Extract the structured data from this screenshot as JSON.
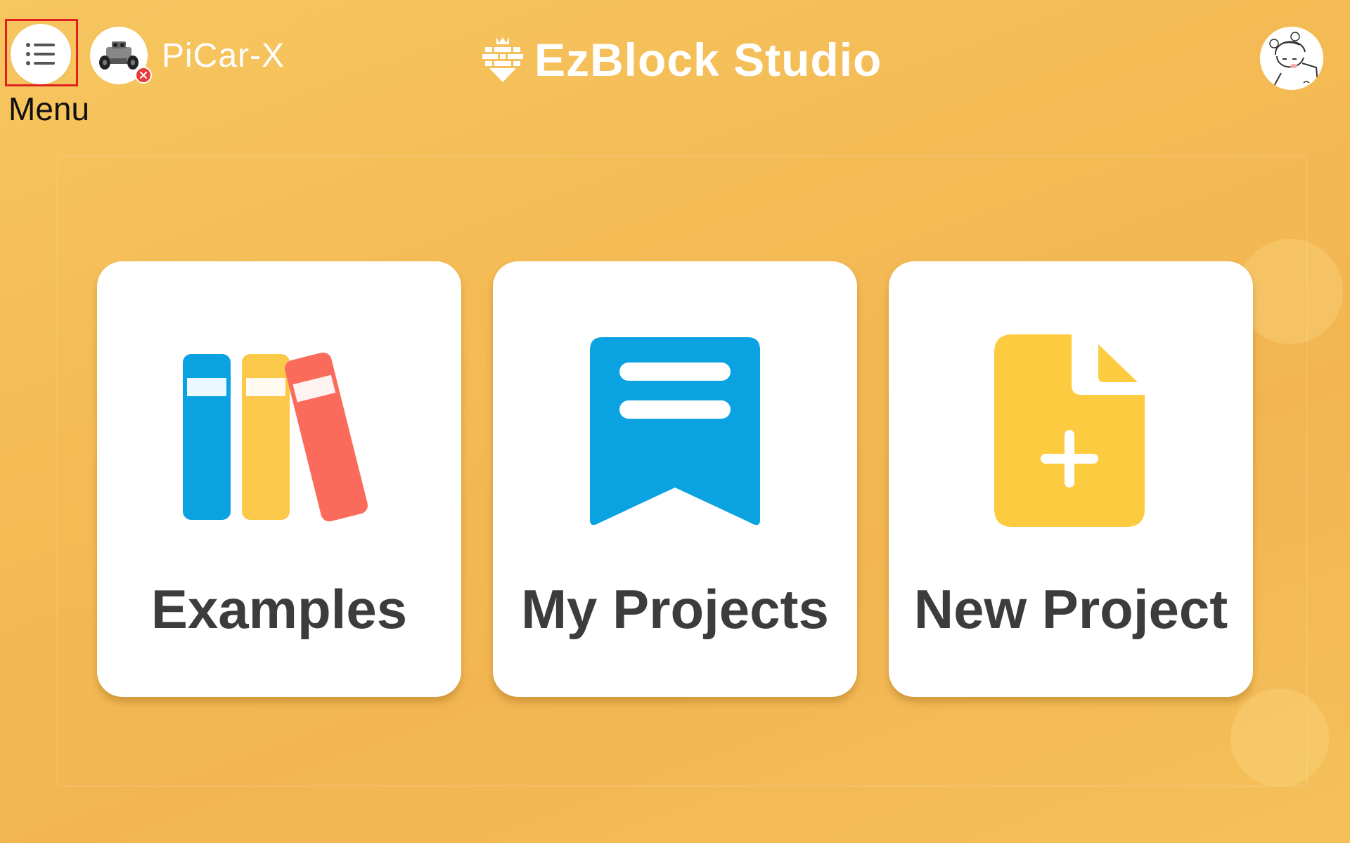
{
  "header": {
    "menu_label": "Menu",
    "device_name": "PiCar-X",
    "brand_title": "EzBlock Studio"
  },
  "icons": {
    "menu": "list-icon",
    "device": "robot-car-icon",
    "device_status": "close-icon",
    "brand": "ezblock-logo-icon",
    "avatar": "user-avatar"
  },
  "cards": [
    {
      "label": "Examples",
      "icon": "books-icon"
    },
    {
      "label": "My Projects",
      "icon": "bookmark-icon"
    },
    {
      "label": "New Project",
      "icon": "new-file-icon"
    }
  ],
  "colors": {
    "background": "#f4bb55",
    "card": "#ffffff",
    "label": "#3c3c3c",
    "blue": "#0aa2e0",
    "yellow": "#fcc84a",
    "red": "#fb6b5b",
    "highlight": "#e02020"
  }
}
